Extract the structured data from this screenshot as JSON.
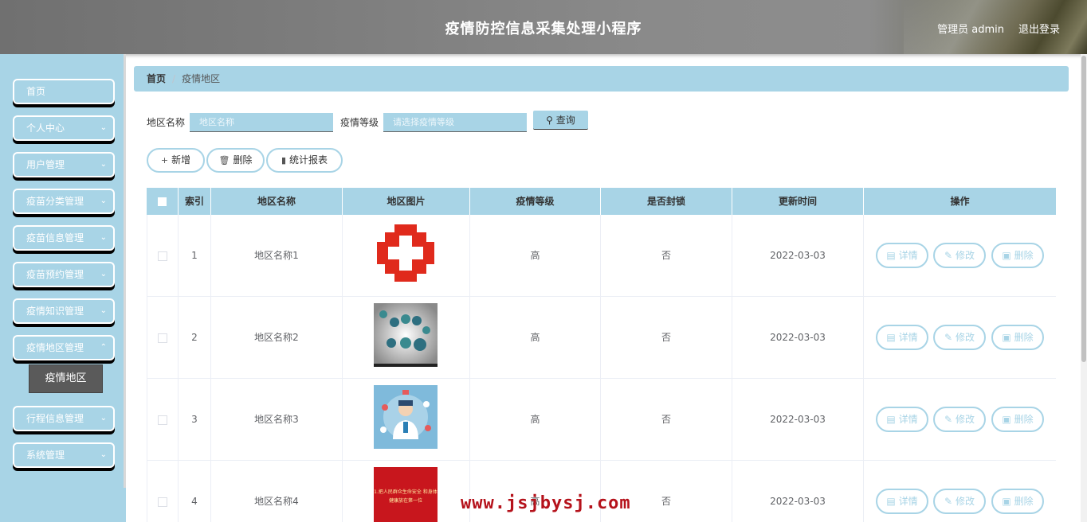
{
  "header": {
    "title": "疫情防控信息采集处理小程序",
    "user": "管理员 admin",
    "logout": "退出登录"
  },
  "sidebar": {
    "items": [
      {
        "label": "首页",
        "has_children": false
      },
      {
        "label": "个人中心",
        "has_children": true
      },
      {
        "label": "用户管理",
        "has_children": true
      },
      {
        "label": "疫苗分类管理",
        "has_children": true
      },
      {
        "label": "疫苗信息管理",
        "has_children": true
      },
      {
        "label": "疫苗预约管理",
        "has_children": true
      },
      {
        "label": "疫情知识管理",
        "has_children": true
      },
      {
        "label": "疫情地区管理",
        "has_children": true
      },
      {
        "label": "行程信息管理",
        "has_children": true
      },
      {
        "label": "系统管理",
        "has_children": true
      }
    ],
    "active_submenu": "疫情地区"
  },
  "breadcrumb": {
    "home": "首页",
    "separator": "/",
    "current": "疫情地区"
  },
  "search": {
    "area_label": "地区名称",
    "area_placeholder": "地区名称",
    "level_label": "疫情等级",
    "level_placeholder": "请选择疫情等级",
    "query_button": "查询",
    "query_icon": "search-icon"
  },
  "actions": {
    "add": "新增",
    "delete": "删除",
    "report": "统计报表"
  },
  "table": {
    "columns": [
      "索引",
      "地区名称",
      "地区图片",
      "疫情等级",
      "是否封锁",
      "更新时间",
      "操作"
    ],
    "rows": [
      {
        "index": "1",
        "name": "地区名称1",
        "image": "red-cross-logo",
        "level": "高",
        "locked": "否",
        "updated": "2022-03-03"
      },
      {
        "index": "2",
        "name": "地区名称2",
        "image": "medical-icons-circle",
        "level": "高",
        "locked": "否",
        "updated": "2022-03-03"
      },
      {
        "index": "3",
        "name": "地区名称3",
        "image": "doctor-illustration",
        "level": "高",
        "locked": "否",
        "updated": "2022-03-03"
      },
      {
        "index": "4",
        "name": "地区名称4",
        "image": "red-banner",
        "level": "高",
        "locked": "否",
        "updated": "2022-03-03"
      }
    ],
    "row_actions": {
      "detail": "详情",
      "edit": "修改",
      "delete": "删除"
    }
  },
  "banner_text": "1.把人民群众生命安全 和身体健康放在第一位",
  "watermark": "www.jsjbysj.com",
  "colors": {
    "accent": "#a8d4e6",
    "header": "#7d7d7d",
    "submenu_active": "#5a5a5a"
  }
}
